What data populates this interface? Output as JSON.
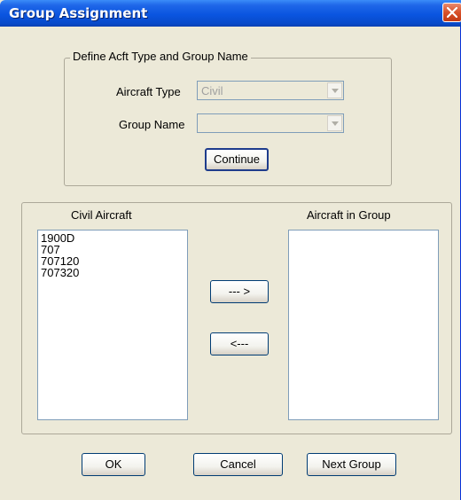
{
  "window": {
    "title": "Group Assignment"
  },
  "define_group": {
    "legend": "Define Acft Type and Group Name",
    "aircraft_type_label": "Aircraft Type",
    "aircraft_type_value": "Civil",
    "group_name_label": "Group Name",
    "group_name_value": "",
    "continue_label": "Continue"
  },
  "lists": {
    "left_header": "Civil Aircraft",
    "right_header": "Aircraft in Group",
    "left_items": [
      "1900D",
      "707",
      "707120",
      "707320"
    ],
    "right_items": [],
    "add_label": "--- >",
    "remove_label": "<---"
  },
  "footer": {
    "ok_label": "OK",
    "cancel_label": "Cancel",
    "next_group_label": "Next Group"
  },
  "colors": {
    "title_bar": "#0a55e0",
    "dialog_bg": "#ece9d8",
    "close_button": "#d8512a"
  }
}
